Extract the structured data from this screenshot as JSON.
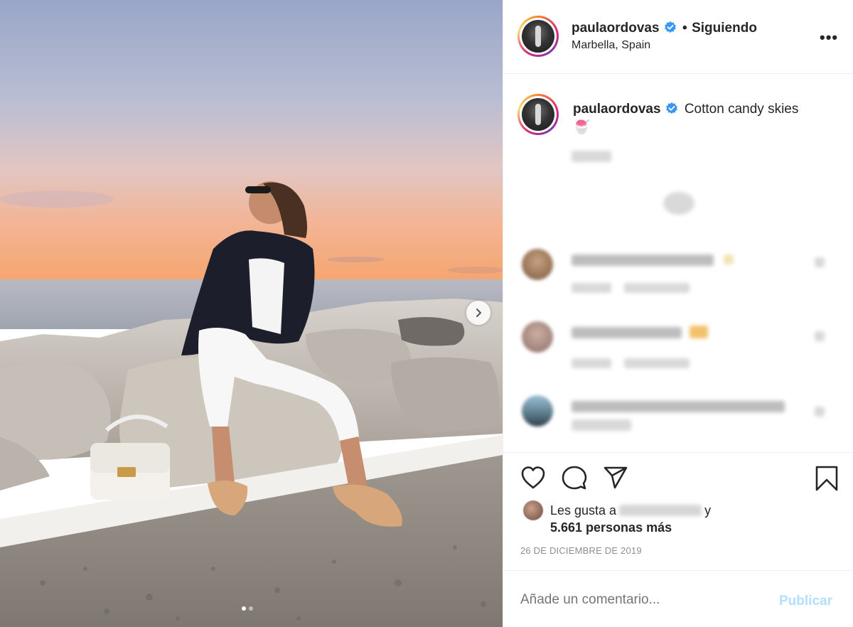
{
  "post": {
    "username": "paulaordovas",
    "follow_status": "Siguiendo",
    "separator": "•",
    "location": "Marbella, Spain",
    "more_label": "•••",
    "caption": "Cotton candy skies",
    "caption_emoji": "🍧",
    "likes_prefix": "Les gusta a",
    "likes_suffix": "y",
    "likes_count": "5.661 personas más",
    "date": "26 DE DICIEMBRE DE 2019",
    "comment_placeholder": "Añade un comentario...",
    "publish_label": "Publicar"
  },
  "carousel": {
    "slide_count": 2,
    "active_index": 0
  },
  "colors": {
    "verified": "#3897f0",
    "publish_disabled": "#b2dffc",
    "secondary_text": "#8e8e8e"
  },
  "icons": [
    "heart-icon",
    "comment-icon",
    "share-icon",
    "bookmark-icon",
    "chevron-right-icon",
    "verified-icon"
  ]
}
